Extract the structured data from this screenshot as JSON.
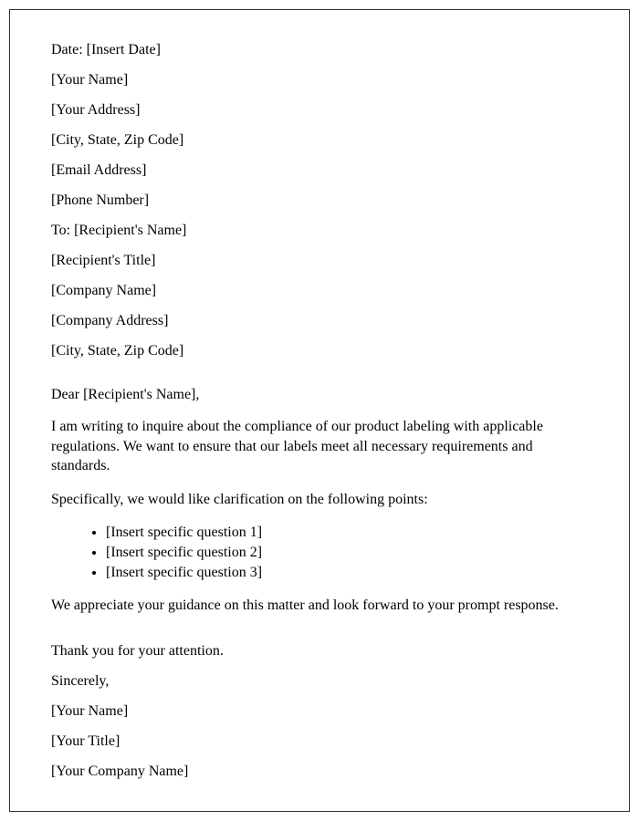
{
  "header": {
    "date_line": "Date: [Insert Date]",
    "your_name": "[Your Name]",
    "your_address": "[Your Address]",
    "your_city_state_zip": "[City, State, Zip Code]",
    "email": "[Email Address]",
    "phone": "[Phone Number]",
    "to_line": "To: [Recipient's Name]",
    "recipient_title": "[Recipient's Title]",
    "company_name": "[Company Name]",
    "company_address": "[Company Address]",
    "company_city_state_zip": "[City, State, Zip Code]"
  },
  "body": {
    "salutation": "Dear [Recipient's Name],",
    "para1": "I am writing to inquire about the compliance of our product labeling with applicable regulations. We want to ensure that our labels meet all necessary requirements and standards.",
    "para2": "Specifically, we would like clarification on the following points:",
    "questions": {
      "q1": "[Insert specific question 1]",
      "q2": "[Insert specific question 2]",
      "q3": "[Insert specific question 3]"
    },
    "para3": "We appreciate your guidance on this matter and look forward to your prompt response."
  },
  "closing": {
    "thanks": "Thank you for your attention.",
    "signoff": "Sincerely,",
    "your_name": "[Your Name]",
    "your_title": "[Your Title]",
    "your_company": "[Your Company Name]"
  }
}
